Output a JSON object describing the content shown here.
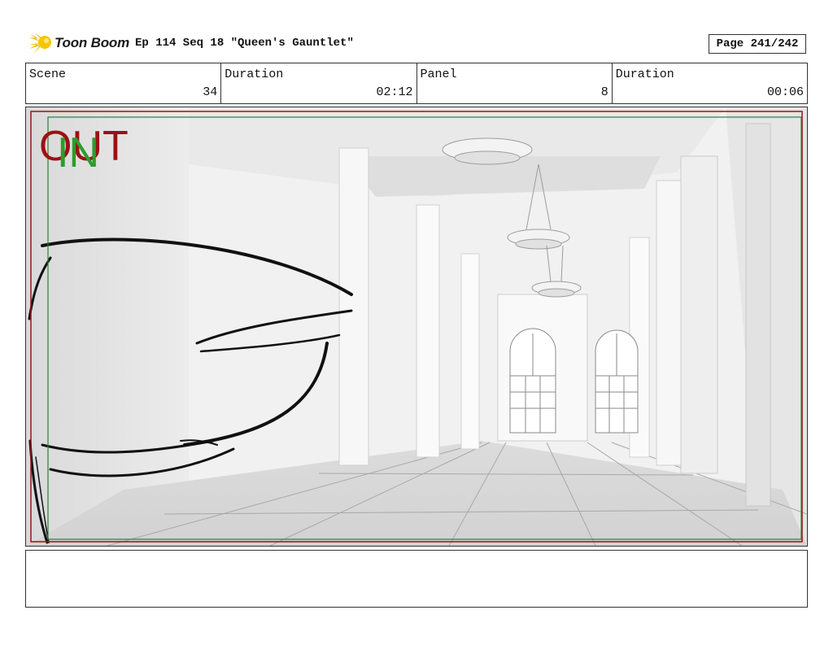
{
  "header": {
    "logo_text": "Toon Boom",
    "title": "Ep 114 Seq 18 \"Queen's Gauntlet\"",
    "page": "Page 241/242"
  },
  "info": {
    "scene_label": "Scene",
    "scene_value": "34",
    "scene_duration_label": "Duration",
    "scene_duration_value": "02:12",
    "panel_label": "Panel",
    "panel_value": "8",
    "panel_duration_label": "Duration",
    "panel_duration_value": "00:06"
  },
  "panel": {
    "out_label": "OUT",
    "in_label": "IN",
    "out_color": "#9a1212",
    "in_color": "#2e9b2e"
  },
  "notes": {
    "text": ""
  }
}
